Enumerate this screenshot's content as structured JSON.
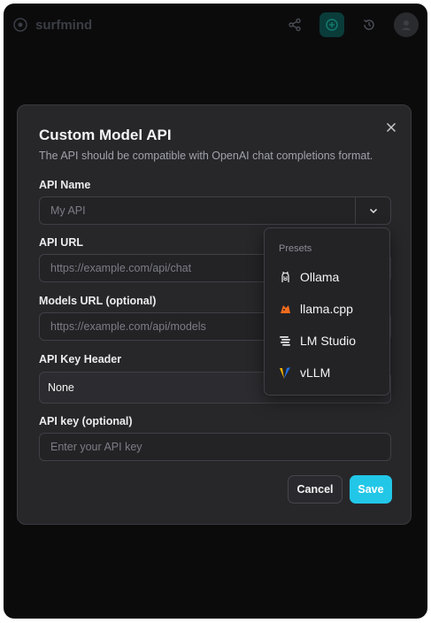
{
  "app": {
    "name": "surfmind"
  },
  "dialog": {
    "title": "Custom Model API",
    "description": "The API should be compatible with OpenAI chat completions format.",
    "fields": {
      "api_name": {
        "label": "API Name",
        "placeholder": "My API",
        "value": ""
      },
      "api_url": {
        "label": "API URL",
        "placeholder": "https://example.com/api/chat",
        "value": ""
      },
      "models_url": {
        "label": "Models URL (optional)",
        "placeholder": "https://example.com/api/models",
        "value": ""
      },
      "api_key_header": {
        "label": "API Key Header",
        "value": "None"
      },
      "api_key": {
        "label": "API key (optional)",
        "placeholder": "Enter your API key",
        "value": ""
      }
    },
    "buttons": {
      "cancel": "Cancel",
      "save": "Save"
    }
  },
  "presets": {
    "title": "Presets",
    "items": [
      {
        "label": "Ollama",
        "icon": "ollama-icon"
      },
      {
        "label": "llama.cpp",
        "icon": "llama-cpp-icon"
      },
      {
        "label": "LM Studio",
        "icon": "lm-studio-icon"
      },
      {
        "label": "vLLM",
        "icon": "vllm-icon"
      }
    ]
  },
  "colors": {
    "accent": "#22c7e8",
    "dialog_bg": "#27272a",
    "page_bg": "#0b0b0c",
    "active_icon_bg": "#0a3c3a"
  }
}
